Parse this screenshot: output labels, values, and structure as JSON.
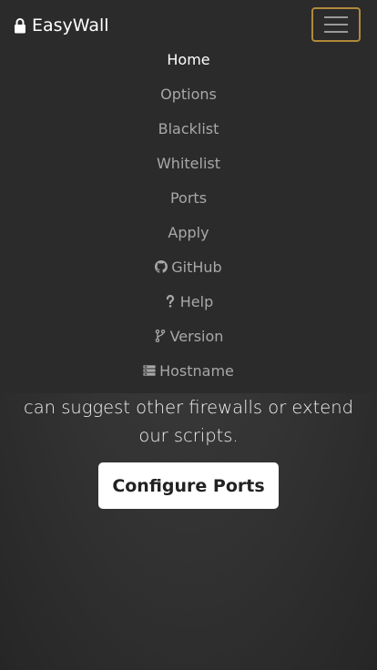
{
  "brand": {
    "icon": "lock-icon",
    "title": "EasyWall"
  },
  "toggler": {
    "icon": "hamburger-icon",
    "border_color": "#b08a3a"
  },
  "nav": {
    "items": [
      {
        "label": "Home",
        "active": true
      },
      {
        "label": "Options"
      },
      {
        "label": "Blacklist"
      },
      {
        "label": "Whitelist"
      },
      {
        "label": "Ports"
      },
      {
        "label": "Apply"
      },
      {
        "label": "GitHub",
        "icon": "github-icon"
      },
      {
        "label": "Help",
        "icon": "question-icon"
      },
      {
        "label": "Version",
        "icon": "branch-icon"
      },
      {
        "label": "Hostname",
        "icon": "server-icon"
      }
    ]
  },
  "main": {
    "lead_text": "can suggest other firewalls or extend our scripts.",
    "cta_label": "Configure Ports"
  },
  "colors": {
    "background": "#333333",
    "navbar": "#2b2b2c",
    "nav_inactive": "#a8a8a8",
    "nav_active": "#ffffff"
  }
}
